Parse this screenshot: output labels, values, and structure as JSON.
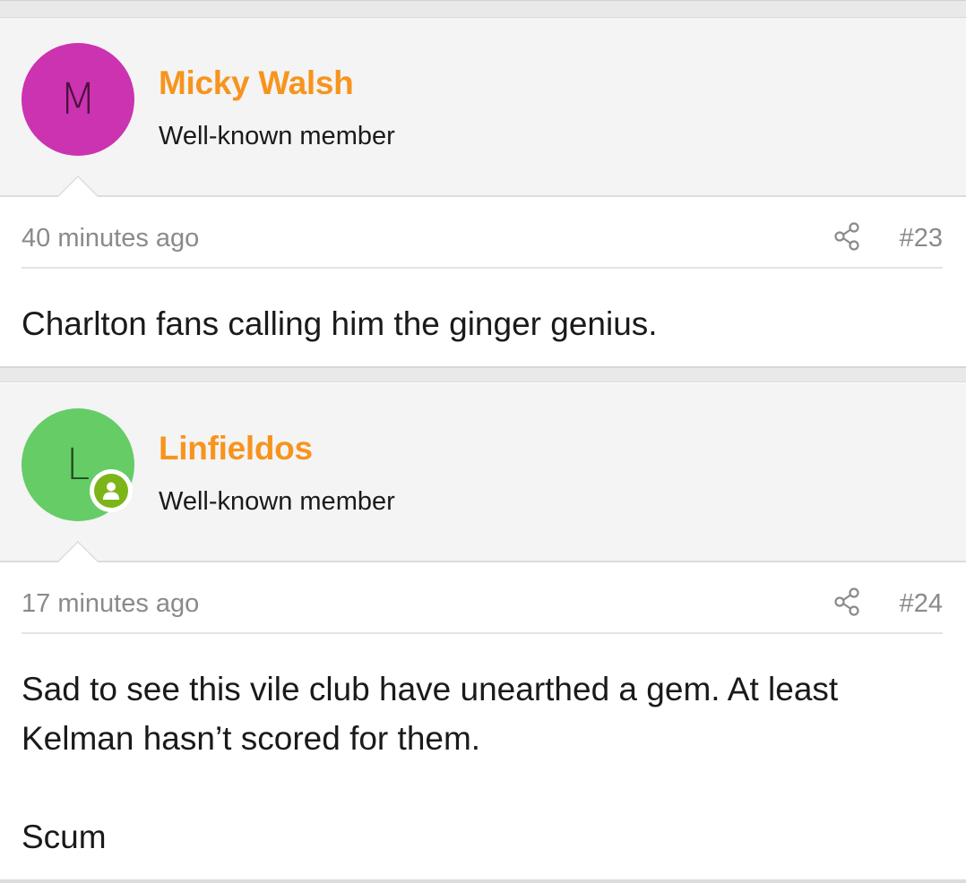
{
  "posts": [
    {
      "username": "Micky Walsh",
      "user_title": "Well-known member",
      "avatar_letter": "M",
      "avatar_color": "#cc33b0",
      "avatar_letter_color": "#4a1140",
      "online": false,
      "time": "40 minutes ago",
      "post_number": "#23",
      "body": "Charlton fans calling him the ginger genius."
    },
    {
      "username": "Linfieldos",
      "user_title": "Well-known member",
      "avatar_letter": "L",
      "avatar_color": "#66cc66",
      "avatar_letter_color": "#1f4d1f",
      "online": true,
      "online_icon": "user-online-icon",
      "time": "17 minutes ago",
      "post_number": "#24",
      "body": "Sad to see this vile club have unearthed a gem. At least Kelman hasn’t scored for them.\n\nScum"
    }
  ],
  "colors": {
    "username": "#f7941d",
    "online_badge": "#7cb518",
    "meta_text": "#8a8a8a"
  },
  "icons": {
    "share": "share-icon"
  }
}
